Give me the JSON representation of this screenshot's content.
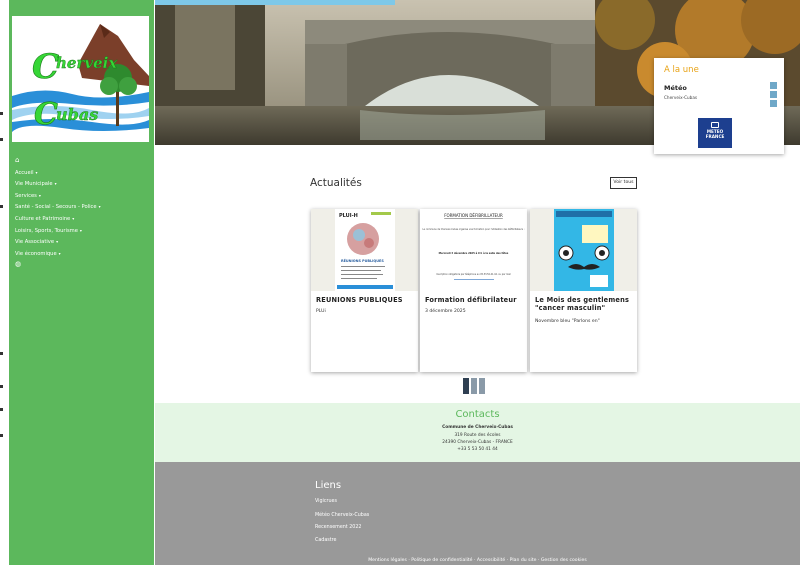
{
  "sidebar": {
    "logo_alt": "Cherveix Cubas",
    "nav": [
      {
        "label": "Accueil",
        "caret": "▾"
      },
      {
        "label": "Vie Municipale",
        "caret": "▾"
      },
      {
        "label": "Services",
        "caret": "▾"
      },
      {
        "label": "Santé - Social - Secours - Police",
        "caret": "▾"
      },
      {
        "label": "Culture et Patrimoine",
        "caret": "▾"
      },
      {
        "label": "Loisirs, Sports, Tourisme",
        "caret": "▾"
      },
      {
        "label": "Vie Associative",
        "caret": "▾"
      },
      {
        "label": "Vie économique",
        "caret": "▾"
      }
    ],
    "home_icon": "home-icon",
    "globe_icon": "globe-icon"
  },
  "alaune": {
    "title": "A la une",
    "weather_title": "Météo",
    "weather_sub": "Cherveix-Cubas",
    "meteo_logo_line1": "METEO",
    "meteo_logo_line2": "FRANCE"
  },
  "news": {
    "title": "Actualités",
    "voir_tous": "Voir tous",
    "cards": [
      {
        "title": "REUNIONS PUBLIQUES",
        "sub": "PLUi",
        "thumb_head": "PLUI-H",
        "thumb_sub": "RÉUNIONS PUBLIQUES"
      },
      {
        "title": "Formation défibrilateur",
        "sub": "3 décembre 2025",
        "thumb_head": "FORMATION DÉFIBRILLATEUR",
        "thumb_text1": "La commune de Cherveix-Cubas organise une formation pour l'utilisation des défibrillateurs :",
        "thumb_text2": "Mercredi 3 décembre 2025 à 9 h à la salle des fêtes",
        "thumb_text3": "Inscription obligatoire par téléphone au 05.53.50.41.44. ou par mail"
      },
      {
        "title": "Le Mois des gentlemens \"cancer masculin\"",
        "sub": "Novembre bleu \"Parlons en\""
      }
    ]
  },
  "contacts": {
    "title": "Contacts",
    "name": "Commune de Cherveix-Cubas",
    "address": "319 Route des écoles",
    "city": "24390 Cherveix-Cubas - FRANCE",
    "phone": "+33 5 53 50 41 44"
  },
  "links": {
    "title": "Liens",
    "items": [
      "Vigicrues",
      "Météo Cherveix-Cubas",
      "Recensement 2022",
      "Cadastre"
    ],
    "legal": "Mentions légales · Politique de confidentialité · Accessibilité · Plan du site · Gestion des cookies"
  },
  "colors": {
    "sidebar_green": "#5cb85c",
    "alaune_accent": "#e8a317",
    "contacts_bg": "#e4f6e4",
    "footer_grey": "#999999",
    "meteo_blue": "#1d3f8f"
  }
}
